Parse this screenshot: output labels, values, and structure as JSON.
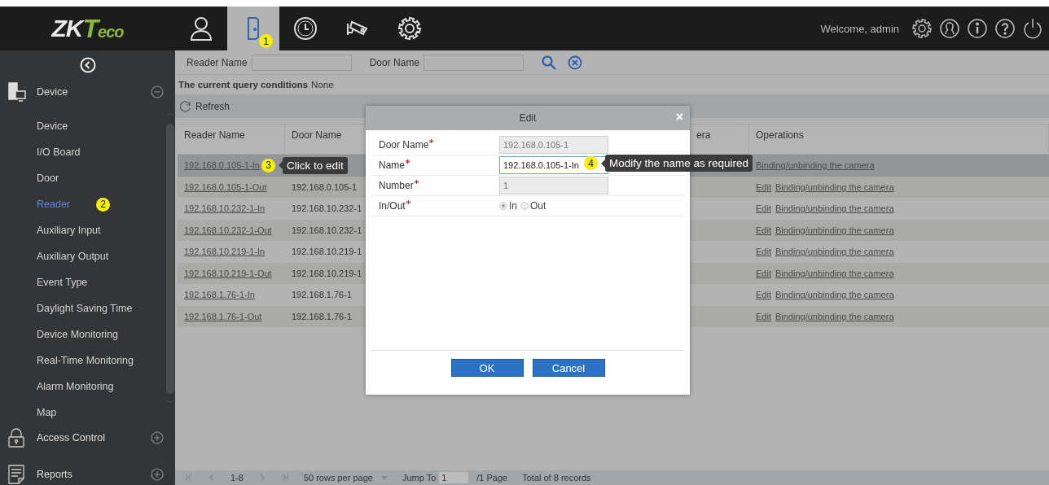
{
  "topbar": {
    "logo": [
      {
        "text": "ZK",
        "kind": "plain"
      },
      {
        "text": "Teco",
        "kind": "accent"
      }
    ],
    "tabs": [
      {
        "kind": "person",
        "selected": false
      },
      {
        "kind": "door",
        "selected": true,
        "badge": "1"
      },
      {
        "kind": "clock",
        "selected": false
      },
      {
        "kind": "camera",
        "selected": false
      },
      {
        "kind": "gear",
        "selected": false
      }
    ],
    "welcome": "Welcome, admin"
  },
  "sidebar": {
    "groups": [
      {
        "label": "Device",
        "kind": "device",
        "expanded": true,
        "items": [
          {
            "label": "Device",
            "selected": false
          },
          {
            "label": "I/O Board",
            "selected": false
          },
          {
            "label": "Door",
            "selected": false
          },
          {
            "label": "Reader",
            "selected": true,
            "badge": "2"
          },
          {
            "label": "Auxiliary Input",
            "selected": false
          },
          {
            "label": "Auxiliary Output",
            "selected": false
          },
          {
            "label": "Event Type",
            "selected": false
          },
          {
            "label": "Daylight Saving Time",
            "selected": false
          },
          {
            "label": "Device Monitoring",
            "selected": false
          },
          {
            "label": "Real-Time Monitoring",
            "selected": false
          },
          {
            "label": "Alarm Monitoring",
            "selected": false
          },
          {
            "label": "Map",
            "selected": false
          }
        ]
      },
      {
        "label": "Access Control",
        "kind": "lock",
        "expanded": false
      },
      {
        "label": "Reports",
        "kind": "report",
        "expanded": false
      }
    ]
  },
  "filter": {
    "fields": [
      {
        "label": "Reader Name"
      },
      {
        "label": "Door Name"
      }
    ]
  },
  "query": {
    "label": "The current query conditions",
    "value": "None"
  },
  "toolbar": {
    "refresh": "Refresh"
  },
  "table": {
    "columns": [
      {
        "label": "Reader Name"
      },
      {
        "label": "Door Name"
      },
      {
        "label": "era"
      },
      {
        "label": "Operations"
      }
    ],
    "rows": [
      {
        "reader_name": "192.168.0.105-1-In",
        "selected": true,
        "operations": [
          "Binding/unbinding the camera"
        ],
        "callout": {
          "number": "3",
          "text": "Click to edit"
        }
      },
      {
        "reader_name": "192.168.0.105-1-Out",
        "door_name": "192.168.0.105-1",
        "selected": false,
        "operations": [
          "Edit",
          "Binding/unbinding the camera"
        ]
      },
      {
        "reader_name": "192.168.10.232-1-In",
        "door_name": "192.168.10.232-1",
        "selected": false,
        "operations": [
          "Edit",
          "Binding/unbinding the camera"
        ]
      },
      {
        "reader_name": "192.168.10.232-1-Out",
        "door_name": "192.168.10.232-1",
        "selected": false,
        "operations": [
          "Edit",
          "Binding/unbinding the camera"
        ]
      },
      {
        "reader_name": "192.168.10.219-1-In",
        "door_name": "192.168.10.219-1",
        "selected": false,
        "operations": [
          "Edit",
          "Binding/unbinding the camera"
        ]
      },
      {
        "reader_name": "192.168.10.219-1-Out",
        "door_name": "192.168.10.219-1",
        "selected": false,
        "operations": [
          "Edit",
          "Binding/unbinding the camera"
        ]
      },
      {
        "reader_name": "192.168.1.76-1-In",
        "door_name": "192.168.1.76-1",
        "selected": false,
        "operations": [
          "Edit",
          "Binding/unbinding the camera"
        ]
      },
      {
        "reader_name": "192.168.1.76-1-Out",
        "door_name": "192.168.1.76-1",
        "selected": false,
        "operations": [
          "Edit",
          "Binding/unbinding the camera"
        ]
      }
    ]
  },
  "pagination": {
    "range": "1-8",
    "page_size": "50 rows per page",
    "jump_label": "Jump To",
    "page": "1",
    "pages": "/1 Page",
    "total": "Total of 8 records"
  },
  "dialog": {
    "title": "Edit",
    "close": "×",
    "fields": [
      {
        "label": "Door Name",
        "required": true,
        "kind": "text",
        "value": "192.168.0.105-1",
        "disabled": true
      },
      {
        "label": "Name",
        "required": true,
        "kind": "text",
        "value": "192.168.0.105-1-In",
        "disabled": false,
        "callout": {
          "number": "4",
          "text": "Modify the name as required"
        }
      },
      {
        "label": "Number",
        "required": true,
        "kind": "text",
        "value": "1",
        "disabled": true
      },
      {
        "label": "In/Out",
        "required": true,
        "kind": "radio",
        "options": [
          {
            "label": "In",
            "selected": true
          },
          {
            "label": "Out",
            "selected": false
          }
        ]
      }
    ],
    "buttons": [
      "OK",
      "Cancel"
    ]
  }
}
